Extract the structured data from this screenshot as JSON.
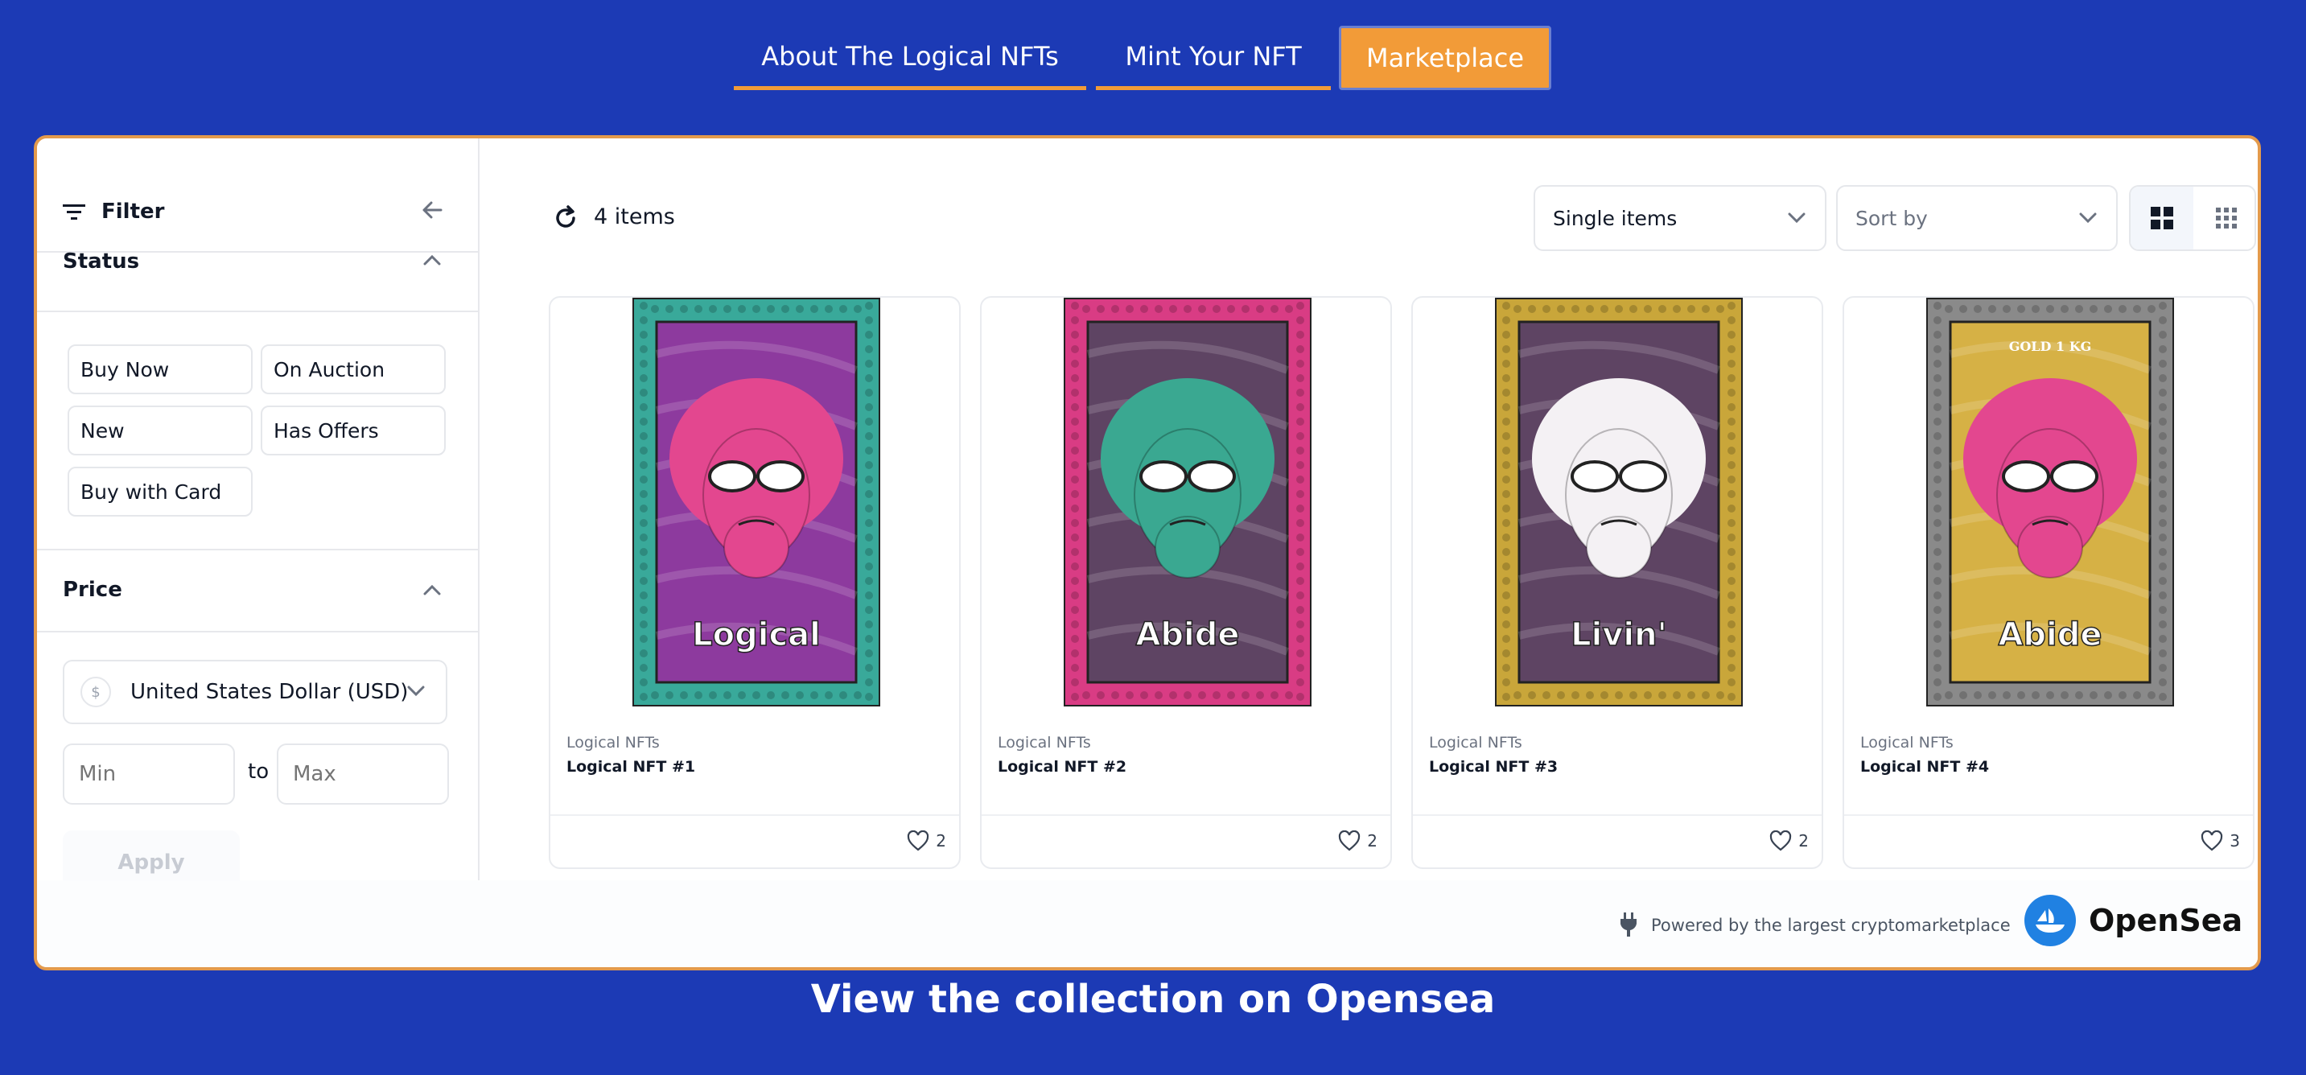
{
  "nav": {
    "tabs": [
      {
        "label": "About The Logical NFTs"
      },
      {
        "label": "Mint Your NFT"
      },
      {
        "label": "Marketplace"
      }
    ]
  },
  "sidebar": {
    "filter_label": "Filter",
    "status": {
      "title": "Status",
      "options": [
        "Buy Now",
        "On Auction",
        "New",
        "Has Offers",
        "Buy with Card"
      ]
    },
    "price": {
      "title": "Price",
      "currency_symbol": "$",
      "currency": "United States Dollar (USD)",
      "min_placeholder": "Min",
      "to": "to",
      "max_placeholder": "Max",
      "apply": "Apply"
    }
  },
  "toolbar": {
    "items_count": "4 items",
    "listing_type": "Single items",
    "sort": "Sort by"
  },
  "cards": [
    {
      "collection": "Logical NFTs",
      "name": "Logical NFT #1",
      "favorites": "2",
      "word": "Logical",
      "border": "#39a99a",
      "bg": "#8d3a9e",
      "head": "#e3478f"
    },
    {
      "collection": "Logical NFTs",
      "name": "Logical NFT #2",
      "favorites": "2",
      "word": "Abide",
      "border": "#d93c84",
      "bg": "#5e4463",
      "head": "#3aa891"
    },
    {
      "collection": "Logical NFTs",
      "name": "Logical NFT #3",
      "favorites": "2",
      "word": "Livin'",
      "border": "#c9a63a",
      "bg": "#5e4463",
      "head": "#f4f1f4"
    },
    {
      "collection": "Logical NFTs",
      "name": "Logical NFT #4",
      "favorites": "3",
      "word": "Abide",
      "border": "#8a8a8a",
      "bg": "#d6b145",
      "head": "#e3478f",
      "top_text": "GOLD 1 KG"
    }
  ],
  "footer": {
    "powered": "Powered by the largest cryptomarketplace",
    "brand": "OpenSea"
  },
  "view_collection": "View the collection on Opensea",
  "colors": {
    "page_bg": "#1c3ab5",
    "accent": "#f29b38",
    "opensea_blue": "#2081e2"
  }
}
